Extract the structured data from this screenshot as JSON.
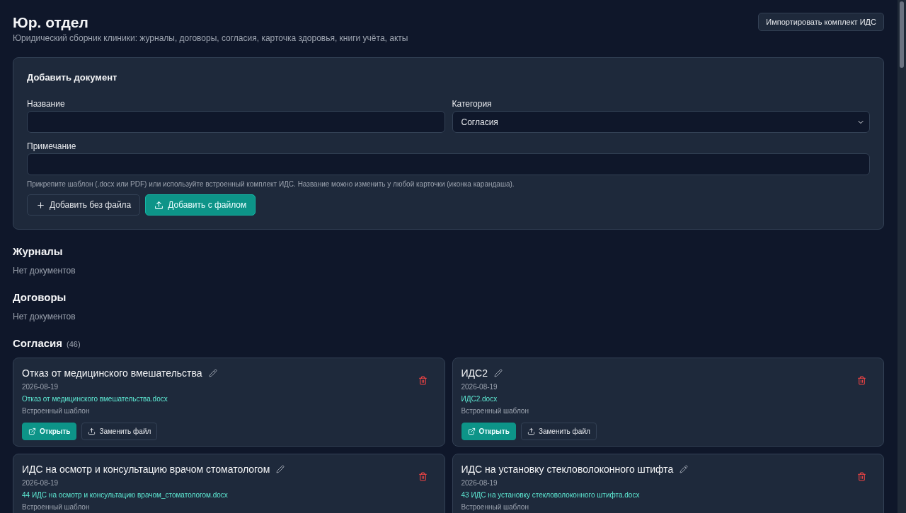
{
  "header": {
    "title": "Юр. отдел",
    "subtitle": "Юридический сборник клиники: журналы, договоры, согласия, карточка здоровья, книги учёта, акты",
    "import_button": "Импортировать комплект ИДС"
  },
  "add_form": {
    "title": "Добавить документ",
    "name_label": "Название",
    "category_label": "Категория",
    "category_value": "Согласия",
    "note_label": "Примечание",
    "hint": "Прикрепите шаблон (.docx или PDF) или используйте встроенный комплект ИДС. Название можно изменить у любой карточки (иконка карандаша).",
    "buttons": [
      {
        "kind": "plain",
        "label": "Добавить без файла"
      },
      {
        "kind": "primary",
        "label": "Добавить с файлом"
      }
    ]
  },
  "sections": [
    {
      "title": "Журналы",
      "empty_text": "Нет документов"
    },
    {
      "title": "Договоры",
      "empty_text": "Нет документов"
    },
    {
      "title": "Согласия",
      "count": "(46)",
      "documents": [
        {
          "title": "Отказ от медицинского вмешательства",
          "date": "2026-08-19",
          "file": "Отказ от медицинского вмешательства.docx",
          "source": "Встроенный шаблон",
          "open_button": "Открыть",
          "replace_button": "Заменить файл"
        },
        {
          "title": "ИДС2",
          "date": "2026-08-19",
          "file": "ИДС2.docx",
          "source": "Встроенный шаблон",
          "open_button": "Открыть",
          "replace_button": "Заменить файл"
        },
        {
          "title": "ИДС на осмотр и консультацию врачом стоматологом",
          "date": "2026-08-19",
          "file": "44 ИДС на осмотр и консультацию врачом_стоматологом.docx",
          "source": "Встроенный шаблон"
        },
        {
          "title": "ИДС на установку стекловолоконного штифта",
          "date": "2026-08-19",
          "file": "43 ИДС на установку стекловолоконного штифта.docx",
          "source": "Встроенный шаблон"
        }
      ]
    }
  ]
}
